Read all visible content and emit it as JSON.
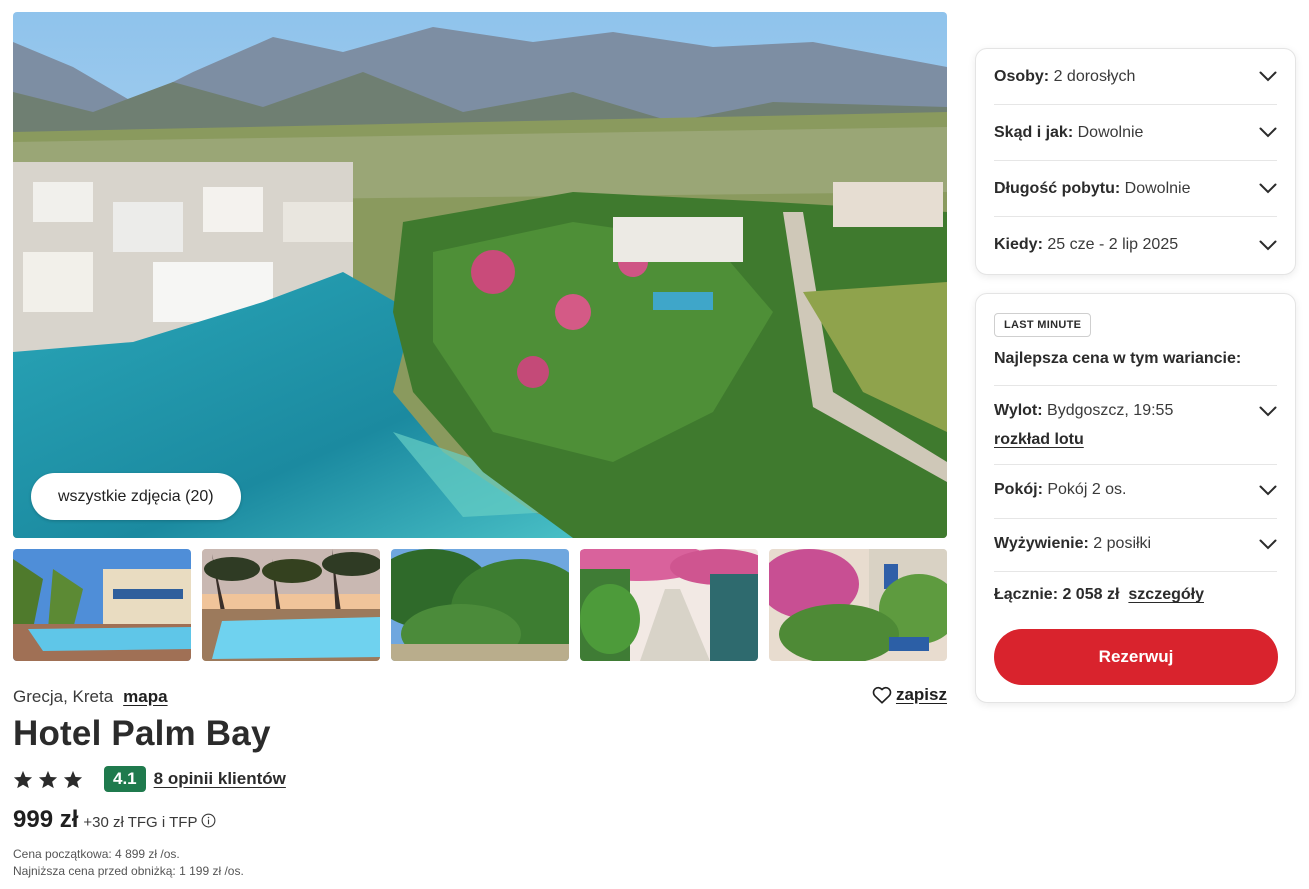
{
  "gallery": {
    "all_photos_label": "wszystkie zdjęcia (20)"
  },
  "hotel": {
    "location": "Grecja, Kreta",
    "map_label": "mapa",
    "save_label": "zapisz",
    "name": "Hotel Palm Bay",
    "stars": 3,
    "rating": "4.1",
    "reviews_label": "8 opinii klientów",
    "price": "999 zł",
    "price_extra": "+30 zł TFG i TFP",
    "initial_price_note": "Cena początkowa: 4 899 zł /os.",
    "lowest_price_note": "Najniższa cena przed obniżką: 1 199 zł /os."
  },
  "params": {
    "persons_label": "Osoby:",
    "persons_value": "2 dorosłych",
    "from_label": "Skąd i jak:",
    "from_value": "Dowolnie",
    "length_label": "Długość pobytu:",
    "length_value": "Dowolnie",
    "when_label": "Kiedy:",
    "when_value": "25 cze - 2 lip 2025"
  },
  "offer": {
    "badge": "LAST MINUTE",
    "heading": "Najlepsza cena w tym wariancie:",
    "flight_label": "Wylot:",
    "flight_value": "Bydgoszcz, 19:55",
    "flight_schedule_link": "rozkład lotu",
    "room_label": "Pokój:",
    "room_value": "Pokój 2 os.",
    "board_label": "Wyżywienie:",
    "board_value": "2 posiłki",
    "total_label": "Łącznie: 2 058 zł",
    "details_link": "szczegóły",
    "book_button": "Rezerwuj"
  },
  "colors": {
    "accent_red": "#d9232d",
    "rating_green": "#1f7a4d"
  },
  "icons": [
    "heart-icon",
    "star-icon",
    "info-icon",
    "chevron-down-icon"
  ]
}
